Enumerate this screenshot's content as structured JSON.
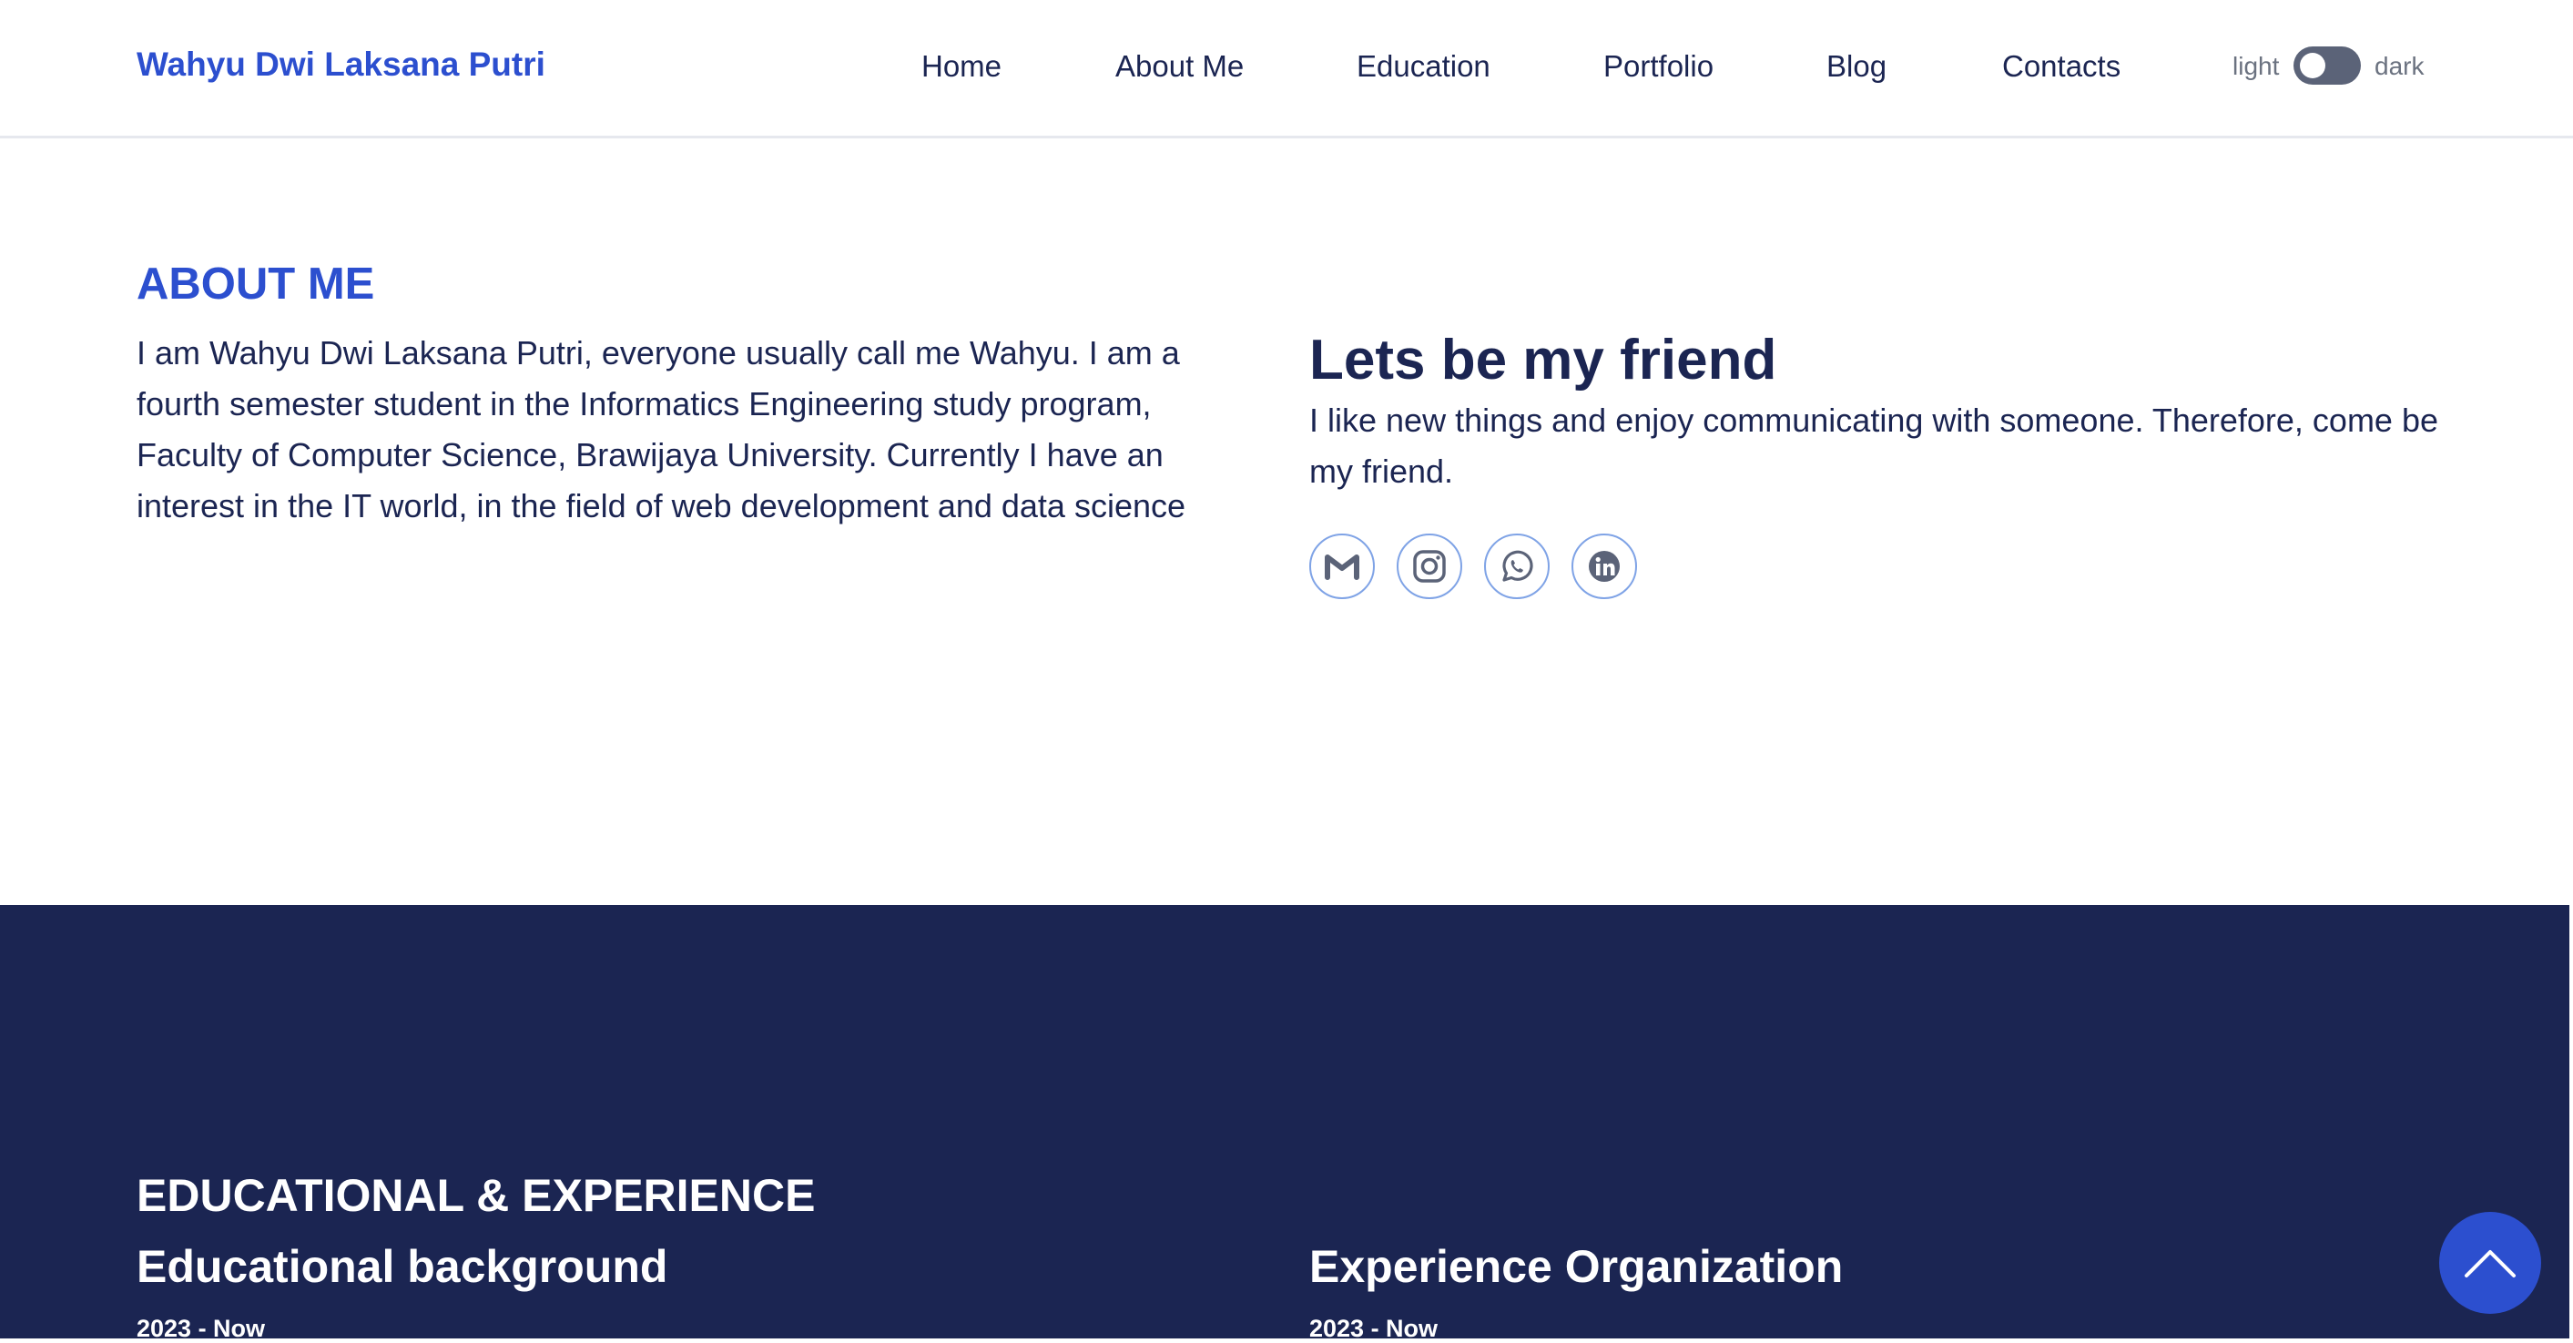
{
  "header": {
    "brand": "Wahyu Dwi Laksana Putri",
    "nav": [
      {
        "label": "Home"
      },
      {
        "label": "About Me"
      },
      {
        "label": "Education"
      },
      {
        "label": "Portfolio"
      },
      {
        "label": "Blog"
      },
      {
        "label": "Contacts"
      }
    ],
    "theme_toggle": {
      "light_label": "light",
      "dark_label": "dark",
      "state": "light"
    }
  },
  "about": {
    "title": "ABOUT ME",
    "text": "I am Wahyu Dwi Laksana Putri, everyone usually call me Wahyu. I am a fourth semester student in the Informatics Engineering study program, Faculty of Computer Science, Brawijaya University. Currently I have an interest in the IT world, in the field of web development and data science"
  },
  "friend": {
    "title": "Lets be my friend",
    "text": "I like new things and enjoy communicating with someone. Therefore, come be my friend.",
    "socials": [
      {
        "icon": "gmail-icon"
      },
      {
        "icon": "instagram-icon"
      },
      {
        "icon": "whatsapp-icon"
      },
      {
        "icon": "linkedin-icon"
      }
    ]
  },
  "education": {
    "title": "EDUCATIONAL & EXPERIENCE",
    "educational_background": {
      "title": "Educational background",
      "period": "2023 - Now"
    },
    "experience_organization": {
      "title": "Experience Organization",
      "period": "2023 - Now"
    }
  },
  "colors": {
    "accent": "#2c4fcf",
    "navy": "#1b2552",
    "icon_border": "#7fa3e6"
  }
}
